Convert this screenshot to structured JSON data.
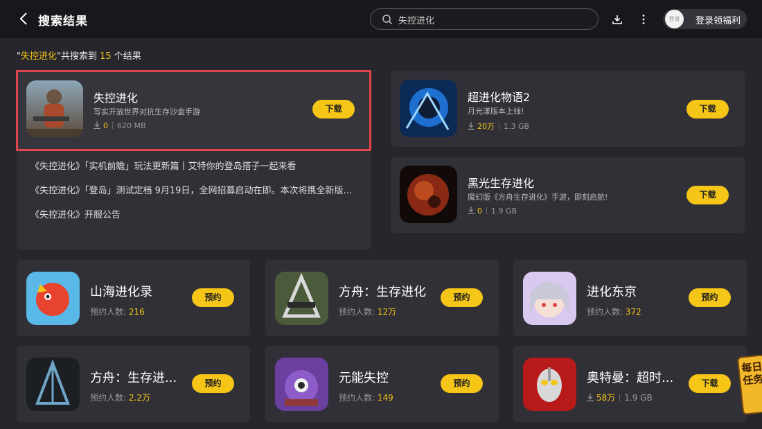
{
  "header": {
    "title": "搜索结果",
    "search_value": "失控进化",
    "login_label": "登录领福利",
    "avatar_text": "登录"
  },
  "summary": {
    "quote_open": "\"",
    "keyword": "失控进化",
    "mid_text": "\"共搜索到 ",
    "count": "15",
    "tail_text": " 个结果"
  },
  "featured": {
    "name": "失控进化",
    "desc": "写实开放世界对抗生存沙盒手游",
    "downloads": "0",
    "size": "620 MB",
    "button": "下载"
  },
  "news": [
    "《失控进化》「实机前瞻」玩法更新篇丨艾特你的登岛搭子一起来看",
    "《失控进化》「登岛」测试定档 9月19日，全网招募启动在即。本次将携全新版…",
    "《失控进化》开服公告"
  ],
  "right_cards": [
    {
      "name": "超进化物语2",
      "desc": "月光漾版本上线!",
      "downloads": "20万",
      "size": "1.3 GB",
      "button": "下载"
    },
    {
      "name": "黑光生存进化",
      "desc": "魔幻版《方舟生存进化》手游，即刻启航!",
      "downloads": "0",
      "size": "1.9 GB",
      "button": "下载"
    }
  ],
  "grid": [
    {
      "name": "山海进化录",
      "meta_label": "预约人数:",
      "meta_value": "216",
      "button": "预约"
    },
    {
      "name": "方舟：生存进化",
      "meta_label": "预约人数:",
      "meta_value": "12万",
      "button": "预约"
    },
    {
      "name": "进化东京",
      "meta_label": "预约人数:",
      "meta_value": "372",
      "button": "预约"
    },
    {
      "name": "方舟：生存进...",
      "meta_label": "预约人数:",
      "meta_value": "2.2万",
      "button": "预约"
    },
    {
      "name": "元能失控",
      "meta_label": "预约人数:",
      "meta_value": "149",
      "button": "预约"
    },
    {
      "name": "奥特曼：超时...",
      "downloads": "58万",
      "size": "1.9 GB",
      "button": "下载"
    }
  ],
  "daily_task": {
    "line1": "每日",
    "line2": "任务"
  },
  "icons": {
    "back": "back-arrow-icon",
    "search": "search-icon",
    "download": "download-icon",
    "more": "more-vertical-icon"
  },
  "colors": {
    "accent": "#f5c518",
    "background": "#26262c",
    "topbar": "#18181c",
    "card": "#303036",
    "selection": "#e2464c"
  }
}
